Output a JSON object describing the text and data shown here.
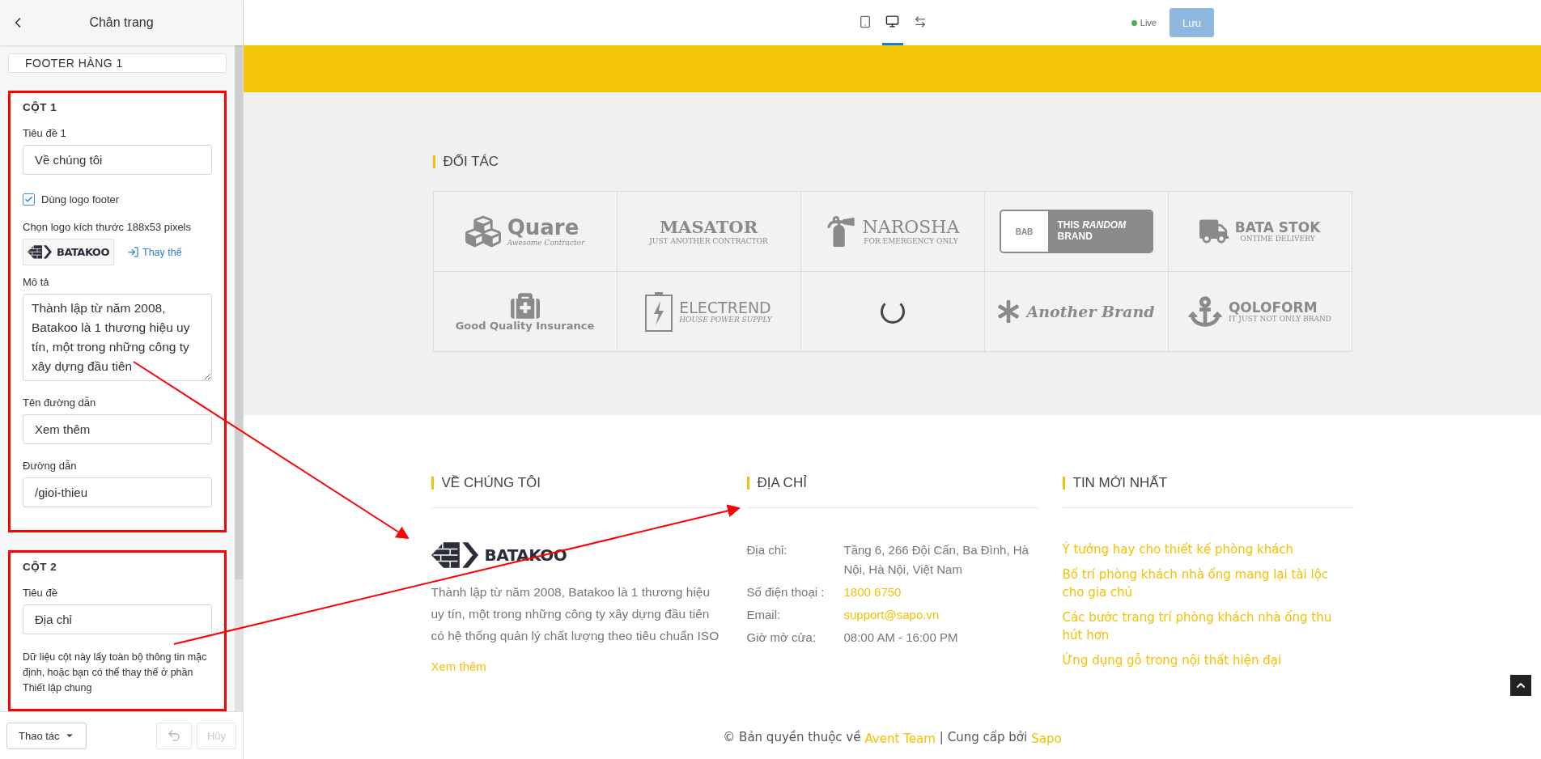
{
  "sidebar": {
    "title": "Chân trang",
    "section_header": "FOOTER HÀNG 1",
    "columns": [
      {
        "heading": "CỘT 1",
        "highlighted": true,
        "fields": [
          {
            "kind": "input",
            "label": "Tiêu đề 1",
            "value": "Về chúng tôi"
          },
          {
            "kind": "checkbox",
            "label": "Dùng logo footer",
            "checked": true
          },
          {
            "kind": "logo",
            "label": "Chọn logo kích thước 188x53 pixels",
            "logo_text": "BATAKOO",
            "action": "Thay thế"
          },
          {
            "kind": "textarea",
            "label": "Mô tả",
            "value": "Thành lập từ năm 2008, Batakoo là 1 thương hiệu uy tín, một trong những công ty xây dựng đầu tiên"
          },
          {
            "kind": "input",
            "label": "Tên đường dẫn",
            "value": "Xem thêm"
          },
          {
            "kind": "input",
            "label": "Đường dẫn",
            "value": "/gioi-thieu"
          }
        ]
      },
      {
        "heading": "CỘT 2",
        "highlighted": true,
        "fields": [
          {
            "kind": "input",
            "label": "Tiêu đề",
            "value": "Địa chỉ"
          },
          {
            "kind": "note",
            "text": "Dữ liệu cột này lấy toàn bộ thông tin mặc định, hoặc bạn có thể thay thế ở phần Thiết lập chung"
          }
        ]
      }
    ],
    "actions_button": "Thao tác",
    "undo": {
      "disabled": true
    },
    "cancel": {
      "label": "Hủy",
      "disabled": true
    }
  },
  "topbar": {
    "views": [
      {
        "kind": "tablet",
        "selected": false
      },
      {
        "kind": "desktop",
        "selected": true
      },
      {
        "kind": "fullwidth",
        "selected": false
      }
    ],
    "status": {
      "label": "Live",
      "color": "#4caf50"
    },
    "save": {
      "label": "Lưu",
      "disabled": true
    }
  },
  "preview": {
    "partners": {
      "title": "ĐỐI TÁC",
      "items": [
        {
          "kind": "cubes",
          "name": "Quare",
          "tagline": "Awesome Contractor"
        },
        {
          "kind": "plain",
          "name": "MASATOR",
          "tagline": "JUST ANOTHER CONTRACTOR"
        },
        {
          "kind": "extinguisher",
          "name": "NAROSHA",
          "tagline": "FOR EMERGENCY ONLY"
        },
        {
          "kind": "badge",
          "badge": "BAB",
          "name": "THIS *RANDOM* BRAND"
        },
        {
          "kind": "truck",
          "name": "BATA STOK",
          "tagline": "ONTIME DELIVERY"
        },
        {
          "kind": "medkit",
          "name": "Good Quality Insurance"
        },
        {
          "kind": "battery",
          "name": "ELECTREND",
          "tagline": "HOUSE POWER SUPPLY"
        },
        {
          "kind": "spinner"
        },
        {
          "kind": "asterisk",
          "name": "Another Brand"
        },
        {
          "kind": "anchor",
          "name": "QOLOFORM",
          "tagline": "IT JUST NOT ONLY BRAND"
        }
      ]
    },
    "footer_columns": [
      {
        "kind": "about",
        "title": "VỀ CHÚNG TÔI",
        "logo_text": "BATAKOO",
        "text": "Thành lập từ năm 2008, Batakoo là 1 thương hiệu uy tín, một trong những công ty xây dựng đầu tiên có hệ thống quản lý chất lượng theo tiêu chuẩn ISO",
        "link": "Xem thêm"
      },
      {
        "kind": "contact",
        "title": "ĐỊA CHỈ",
        "rows": [
          {
            "label": "Địa chỉ:",
            "value": "Tầng 6, 266 Đội Cấn, Ba Đình, Hà Nội, Hà Nội, Việt Nam",
            "kind": "text"
          },
          {
            "label": "Số điện thoại :",
            "value": "1800 6750",
            "kind": "link"
          },
          {
            "label": "Email:",
            "value": "support@sapo.vn",
            "kind": "link"
          },
          {
            "label": "Giờ mở cửa:",
            "value": "08:00 AM - 16:00 PM",
            "kind": "text"
          }
        ]
      },
      {
        "kind": "news",
        "title": "TIN MỚI NHẤT",
        "links": [
          "Ý tưởng hay cho thiết kế phòng khách",
          "Bố trí phòng khách nhà ống mang lại tài lộc cho gia chủ",
          "Các bước trang trí phòng khách nhà ống thu hút hơn",
          "Ứng dụng gỗ trong nội thất hiện đại"
        ]
      }
    ],
    "copyright": {
      "prefix": "© Bản quyền thuộc về",
      "owner": "Avent Team",
      "separator": "|",
      "middle": "Cung cấp bởi",
      "provider": "Sapo"
    }
  }
}
